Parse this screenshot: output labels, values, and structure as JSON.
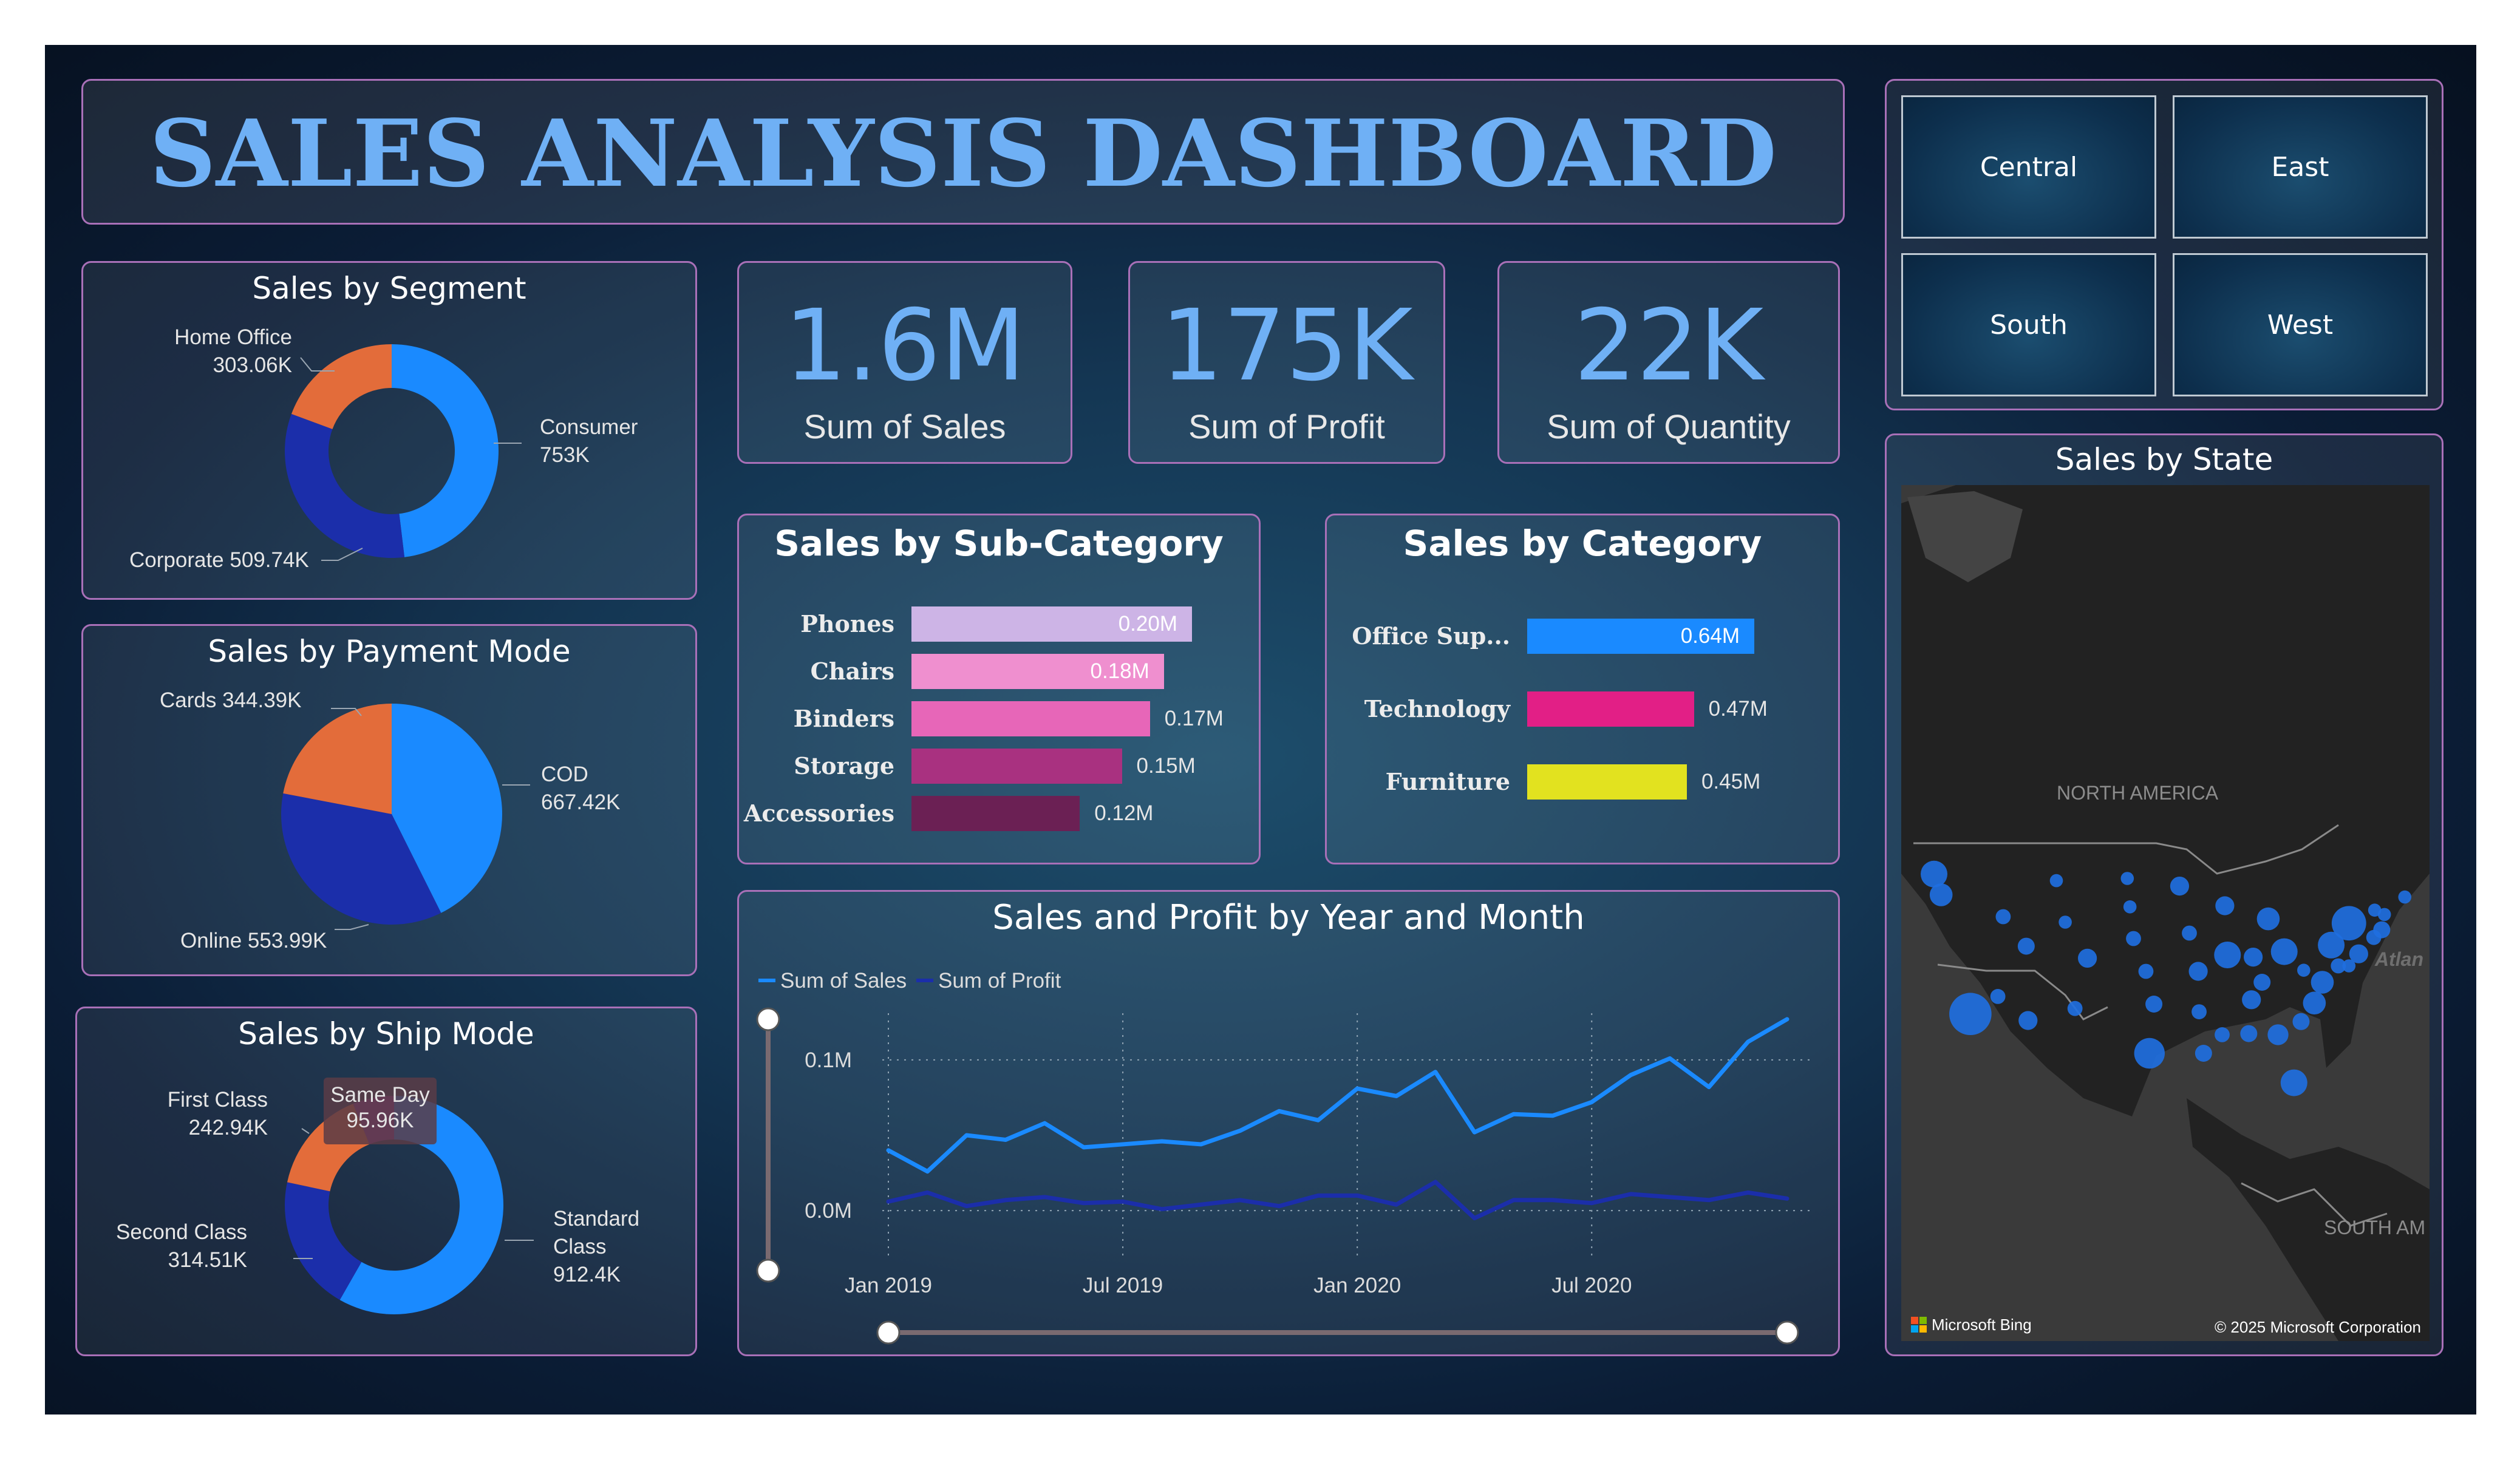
{
  "header": {
    "title": "SALES ANALYSIS DASHBOARD"
  },
  "colors": {
    "accent_blue": "#1a8aff",
    "orange": "#e36c3a",
    "navy": "#1b2eaa",
    "title_blue": "#6fb0f5",
    "panel_border": "#a970b8"
  },
  "kpis": [
    {
      "value": "1.6M",
      "label": "Sum of Sales"
    },
    {
      "value": "175K",
      "label": "Sum of Profit"
    },
    {
      "value": "22K",
      "label": "Sum of Quantity"
    }
  ],
  "regions": [
    "Central",
    "East",
    "South",
    "West"
  ],
  "segment": {
    "title": "Sales by Segment",
    "labels": {
      "home_office_name": "Home Office",
      "home_office_value": "303.06K",
      "consumer_name": "Consumer",
      "consumer_value": "753K",
      "corporate": "Corporate 509.74K"
    }
  },
  "payment": {
    "title": "Sales by Payment Mode",
    "labels": {
      "cards": "Cards 344.39K",
      "cod_name": "COD",
      "cod_value": "667.42K",
      "online": "Online 553.99K"
    }
  },
  "shipmode": {
    "title": "Sales by Ship Mode",
    "labels": {
      "first_name": "First Class",
      "first_value": "242.94K",
      "sameday_name": "Same Day",
      "sameday_value": "95.96K",
      "second_name": "Second Class",
      "second_value": "314.51K",
      "standard_name": "Standard Class",
      "standard_value": "912.4K"
    }
  },
  "subcategory": {
    "title": "Sales by Sub-Category"
  },
  "category": {
    "title": "Sales by Category"
  },
  "linechart": {
    "title": "Sales and Profit by Year and Month",
    "legend_sales": "Sum of Sales",
    "legend_profit": "Sum of Profit"
  },
  "map": {
    "title": "Sales by State",
    "label_na": "NORTH AMERICA",
    "label_sa": "SOUTH AM",
    "label_atl": "Atlan",
    "bing": "Microsoft Bing",
    "copyright": "© 2025 Microsoft Corporation"
  },
  "chart_data": [
    {
      "type": "pie",
      "title": "Sales by Segment",
      "donut": true,
      "slices": [
        {
          "label": "Consumer",
          "value": 753,
          "display": "753K",
          "color": "#1a8aff"
        },
        {
          "label": "Corporate",
          "value": 509.74,
          "display": "509.74K",
          "color": "#1b2eaa"
        },
        {
          "label": "Home Office",
          "value": 303.06,
          "display": "303.06K",
          "color": "#e36c3a"
        }
      ]
    },
    {
      "type": "pie",
      "title": "Sales by Payment Mode",
      "donut": false,
      "slices": [
        {
          "label": "COD",
          "value": 667.42,
          "display": "667.42K",
          "color": "#1a8aff"
        },
        {
          "label": "Online",
          "value": 553.99,
          "display": "553.99K",
          "color": "#1b2eaa"
        },
        {
          "label": "Cards",
          "value": 344.39,
          "display": "344.39K",
          "color": "#e36c3a"
        }
      ]
    },
    {
      "type": "pie",
      "title": "Sales by Ship Mode",
      "donut": true,
      "slices": [
        {
          "label": "Standard Class",
          "value": 912.4,
          "display": "912.4K",
          "color": "#1a8aff"
        },
        {
          "label": "Second Class",
          "value": 314.51,
          "display": "314.51K",
          "color": "#1b2eaa"
        },
        {
          "label": "First Class",
          "value": 242.94,
          "display": "242.94K",
          "color": "#e36c3a"
        },
        {
          "label": "Same Day",
          "value": 95.96,
          "display": "95.96K",
          "color": "#8a2e9c"
        }
      ]
    },
    {
      "type": "bar",
      "title": "Sales by Sub-Category",
      "orientation": "horizontal",
      "categories": [
        "Phones",
        "Chairs",
        "Binders",
        "Storage",
        "Accessories"
      ],
      "values": [
        0.2,
        0.18,
        0.17,
        0.15,
        0.12
      ],
      "labels": [
        "0.20M",
        "0.18M",
        "0.17M",
        "0.15M",
        "0.12M"
      ],
      "colors": [
        "#cdb4e6",
        "#ef8fcf",
        "#e766b8",
        "#a93180",
        "#6b2054"
      ],
      "label_inside": [
        true,
        true,
        false,
        false,
        false
      ],
      "xlim": [
        0,
        0.2
      ]
    },
    {
      "type": "bar",
      "title": "Sales by Category",
      "orientation": "horizontal",
      "categories": [
        "Office Sup...",
        "Technology",
        "Furniture"
      ],
      "values": [
        0.64,
        0.47,
        0.45
      ],
      "labels": [
        "0.64M",
        "0.47M",
        "0.45M"
      ],
      "colors": [
        "#1a8aff",
        "#e21f86",
        "#e2e21f"
      ],
      "label_inside": [
        true,
        false,
        false
      ],
      "xlim": [
        0,
        0.64
      ]
    },
    {
      "type": "line",
      "title": "Sales and Profit by Year and Month",
      "x": [
        "2019-01",
        "2019-02",
        "2019-03",
        "2019-04",
        "2019-05",
        "2019-06",
        "2019-07",
        "2019-08",
        "2019-09",
        "2019-10",
        "2019-11",
        "2019-12",
        "2020-01",
        "2020-02",
        "2020-03",
        "2020-04",
        "2020-05",
        "2020-06",
        "2020-07",
        "2020-08",
        "2020-09",
        "2020-10",
        "2020-11",
        "2020-12"
      ],
      "x_ticks": [
        {
          "at": "2019-01",
          "label": "Jan 2019"
        },
        {
          "at": "2019-07",
          "label": "Jul 2019"
        },
        {
          "at": "2020-01",
          "label": "Jan 2020"
        },
        {
          "at": "2020-07",
          "label": "Jul 2020"
        }
      ],
      "series": [
        {
          "name": "Sum of Sales",
          "color": "#1a8aff",
          "values": [
            0.04,
            0.026,
            0.05,
            0.047,
            0.058,
            0.042,
            0.044,
            0.046,
            0.044,
            0.053,
            0.066,
            0.06,
            0.081,
            0.076,
            0.092,
            0.052,
            0.064,
            0.063,
            0.072,
            0.09,
            0.101,
            0.082,
            0.112,
            0.127
          ]
        },
        {
          "name": "Sum of Profit",
          "color": "#1b2eaa",
          "values": [
            0.006,
            0.012,
            0.003,
            0.007,
            0.009,
            0.005,
            0.006,
            0.001,
            0.004,
            0.007,
            0.003,
            0.01,
            0.01,
            0.004,
            0.019,
            -0.005,
            0.007,
            0.007,
            0.005,
            0.011,
            0.009,
            0.007,
            0.012,
            0.008
          ]
        }
      ],
      "y_ticks": [
        {
          "value": 0,
          "label": "0.0M"
        },
        {
          "value": 0.1,
          "label": "0.1M"
        }
      ],
      "ylim": [
        -0.01,
        0.135
      ],
      "legend": "top-left",
      "grid": true
    },
    {
      "type": "scatter",
      "title": "Sales by State",
      "note": "bubble map of US states over North America",
      "bubble_color": "#1f6fe0",
      "points": [
        {
          "lon": -118.2,
          "lat": 34.6,
          "size": 9
        },
        {
          "lon": -121.5,
          "lat": 45.5,
          "size": 4
        },
        {
          "lon": -122.3,
          "lat": 47.4,
          "size": 5
        },
        {
          "lon": -114.5,
          "lat": 43.5,
          "size": 2
        },
        {
          "lon": -111.9,
          "lat": 40.8,
          "size": 2.5
        },
        {
          "lon": -115.1,
          "lat": 36.2,
          "size": 2
        },
        {
          "lon": -111.7,
          "lat": 34.0,
          "size": 3
        },
        {
          "lon": -105.0,
          "lat": 39.7,
          "size": 3
        },
        {
          "lon": -106.4,
          "lat": 35.1,
          "size": 2
        },
        {
          "lon": -108.5,
          "lat": 46.8,
          "size": 1.5
        },
        {
          "lon": -107.5,
          "lat": 43.0,
          "size": 1.5
        },
        {
          "lon": -100.5,
          "lat": 47.0,
          "size": 1.5
        },
        {
          "lon": -100.2,
          "lat": 44.4,
          "size": 1.5
        },
        {
          "lon": -99.8,
          "lat": 41.5,
          "size": 2
        },
        {
          "lon": -98.4,
          "lat": 38.5,
          "size": 2
        },
        {
          "lon": -97.5,
          "lat": 35.5,
          "size": 2.5
        },
        {
          "lon": -98.0,
          "lat": 31.0,
          "size": 6
        },
        {
          "lon": -94.6,
          "lat": 46.3,
          "size": 3
        },
        {
          "lon": -93.5,
          "lat": 42.0,
          "size": 2
        },
        {
          "lon": -92.5,
          "lat": 38.5,
          "size": 3
        },
        {
          "lon": -92.4,
          "lat": 34.8,
          "size": 2
        },
        {
          "lon": -91.9,
          "lat": 31.0,
          "size": 2.5
        },
        {
          "lon": -89.5,
          "lat": 44.5,
          "size": 3
        },
        {
          "lon": -89.2,
          "lat": 40.0,
          "size": 5
        },
        {
          "lon": -89.8,
          "lat": 32.7,
          "size": 2
        },
        {
          "lon": -86.8,
          "lat": 32.8,
          "size": 2.5
        },
        {
          "lon": -86.3,
          "lat": 39.8,
          "size": 3
        },
        {
          "lon": -84.6,
          "lat": 43.3,
          "size": 4
        },
        {
          "lon": -86.5,
          "lat": 35.9,
          "size": 3
        },
        {
          "lon": -85.3,
          "lat": 37.5,
          "size": 2.5
        },
        {
          "lon": -82.8,
          "lat": 40.3,
          "size": 5
        },
        {
          "lon": -83.5,
          "lat": 32.7,
          "size": 3.5
        },
        {
          "lon": -81.7,
          "lat": 28.3,
          "size": 5
        },
        {
          "lon": -80.9,
          "lat": 33.9,
          "size": 2.5
        },
        {
          "lon": -79.4,
          "lat": 35.6,
          "size": 4
        },
        {
          "lon": -78.5,
          "lat": 37.5,
          "size": 4
        },
        {
          "lon": -80.6,
          "lat": 38.6,
          "size": 1.5
        },
        {
          "lon": -77.5,
          "lat": 40.9,
          "size": 5
        },
        {
          "lon": -75.5,
          "lat": 42.9,
          "size": 7
        },
        {
          "lon": -74.4,
          "lat": 40.1,
          "size": 3
        },
        {
          "lon": -72.7,
          "lat": 41.6,
          "size": 2
        },
        {
          "lon": -71.8,
          "lat": 42.3,
          "size": 2.5
        },
        {
          "lon": -71.5,
          "lat": 43.7,
          "size": 1.5
        },
        {
          "lon": -72.6,
          "lat": 44.1,
          "size": 1.5
        },
        {
          "lon": -69.2,
          "lat": 45.3,
          "size": 1.5
        },
        {
          "lon": -76.7,
          "lat": 39.0,
          "size": 2
        },
        {
          "lon": -75.5,
          "lat": 39.0,
          "size": 1.5
        }
      ]
    }
  ]
}
